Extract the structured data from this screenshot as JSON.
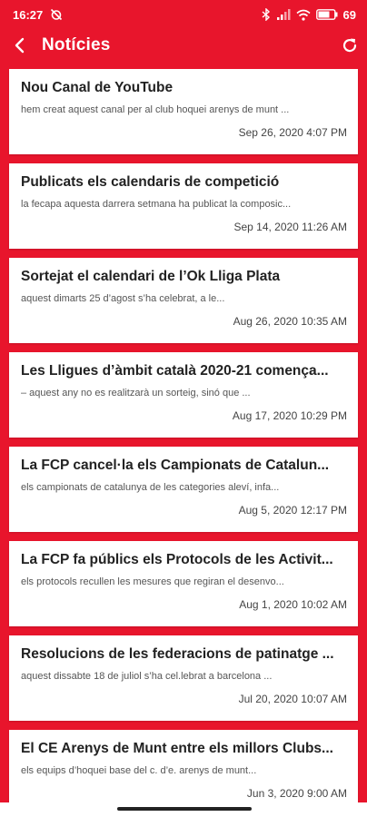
{
  "status": {
    "time": "16:27",
    "battery": "69"
  },
  "appbar": {
    "title": "Notícies",
    "back_icon": "arrow-left-icon",
    "refresh_icon": "refresh-icon"
  },
  "colors": {
    "primary": "#e8152c",
    "card": "#ffffff"
  },
  "news": [
    {
      "title": "Nou Canal de YouTube",
      "excerpt": "hem creat aquest canal per al club hoquei arenys de munt ...",
      "date": "Sep 26, 2020 4:07 PM"
    },
    {
      "title": "Publicats els calendaris de competició",
      "excerpt": "la fecapa aquesta darrera setmana ha publicat la composic...",
      "date": "Sep 14, 2020 11:26 AM"
    },
    {
      "title": "Sortejat el calendari de l’Ok Lliga Plata",
      "excerpt": "aquest dimarts 25 d’agost s’ha celebrat, a le...",
      "date": "Aug 26, 2020 10:35 AM"
    },
    {
      "title": "Les Lligues d’àmbit català 2020-21 comença...",
      "excerpt": "– aquest any no es realitzarà un sorteig, sinó que ...",
      "date": "Aug 17, 2020 10:29 PM"
    },
    {
      "title": "La FCP cancel·la els Campionats de Catalun...",
      "excerpt": "els campionats de catalunya de les categories aleví, infa...",
      "date": "Aug 5, 2020 12:17 PM"
    },
    {
      "title": "La FCP fa públics els Protocols de les Activit...",
      "excerpt": "els protocols recullen les mesures que regiran el desenvo...",
      "date": "Aug 1, 2020 10:02 AM"
    },
    {
      "title": "Resolucions de les federacions de patinatge ...",
      "excerpt": "aquest dissabte 18 de juliol s’ha cel.lebrat a barcelona ...",
      "date": "Jul 20, 2020 10:07 AM"
    },
    {
      "title": "El CE Arenys de Munt entre els millors Clubs...",
      "excerpt": "els equips d’hoquei base del c. d’e. arenys de munt...",
      "date": "Jun 3, 2020 9:00 AM"
    }
  ]
}
